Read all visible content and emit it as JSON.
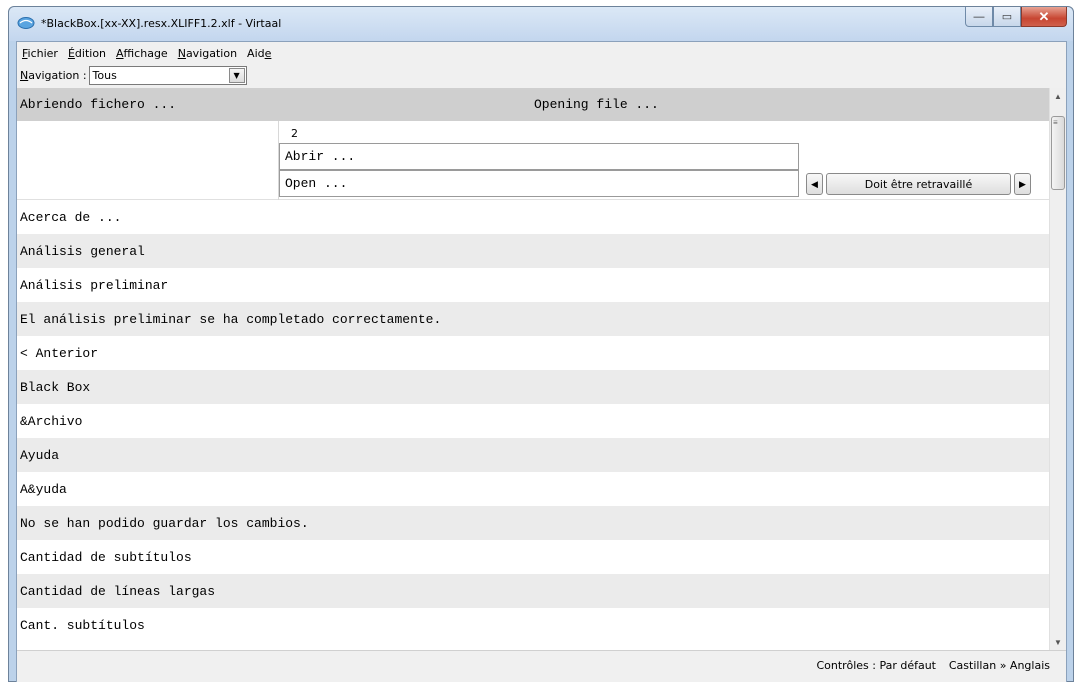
{
  "window": {
    "title": "*BlackBox.[xx-XX].resx.XLIFF1.2.xlf - Virtaal",
    "min_glyph": "—",
    "max_glyph": "▭",
    "close_glyph": "✕"
  },
  "menu": {
    "items": [
      {
        "mnemonic": "F",
        "rest": "ichier"
      },
      {
        "mnemonic": "É",
        "rest": "dition"
      },
      {
        "mnemonic": "A",
        "rest": "ffichage"
      },
      {
        "mnemonic": "N",
        "rest": "avigation"
      },
      {
        "pre": "Aid",
        "mnemonic": "e",
        "rest": ""
      }
    ]
  },
  "navigation": {
    "label_mnemonic": "N",
    "label_rest": "avigation :",
    "selected": "Tous",
    "drop_glyph": "▼"
  },
  "header_row": {
    "source": "Abriendo fichero ...",
    "target": "Opening file ..."
  },
  "editor": {
    "number": "2",
    "source": "Abrir ...",
    "target": "Open ...",
    "prev_glyph": "◀",
    "next_glyph": "▶",
    "state": "Doit être retravaillé"
  },
  "units": [
    "Acerca de ...",
    "Análisis general",
    "Análisis preliminar",
    "El análisis preliminar se ha completado correctamente.",
    "< Anterior",
    "Black Box",
    "&Archivo",
    "Ayuda",
    "A&yuda",
    "No se han podido guardar los cambios.",
    "Cantidad de subtítulos",
    "Cantidad de líneas largas",
    "Cant. subtítulos"
  ],
  "scroll": {
    "up_glyph": "▲",
    "down_glyph": "▼",
    "grip": "≡"
  },
  "status": {
    "controls": "Contrôles : Par défaut",
    "languages": "Castillan » Anglais"
  }
}
